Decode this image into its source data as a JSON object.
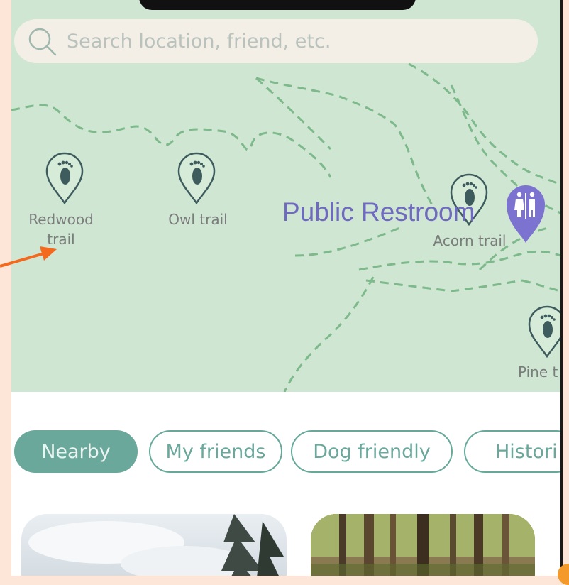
{
  "search": {
    "placeholder": "Search location, friend, etc."
  },
  "map": {
    "trails": [
      {
        "label_line1": "Redwood",
        "label_line2": "trail"
      },
      {
        "label_line1": "Owl trail",
        "label_line2": ""
      },
      {
        "label_line1": "Acorn trail",
        "label_line2": ""
      },
      {
        "label_line1": "Pine t",
        "label_line2": ""
      }
    ],
    "poi": {
      "label": "Public Restroom",
      "icon": "restroom-icon"
    }
  },
  "filters": [
    {
      "label": "Nearby",
      "active": true
    },
    {
      "label": "My friends",
      "active": false
    },
    {
      "label": "Dog friendly",
      "active": false
    },
    {
      "label": "Histori",
      "active": false
    }
  ],
  "colors": {
    "accent": "#6aa89c",
    "map_bg": "#cfe6d3",
    "poi": "#7b73cf",
    "pin": "#3e5c5d",
    "annotation_arrow": "#f36a1f"
  }
}
